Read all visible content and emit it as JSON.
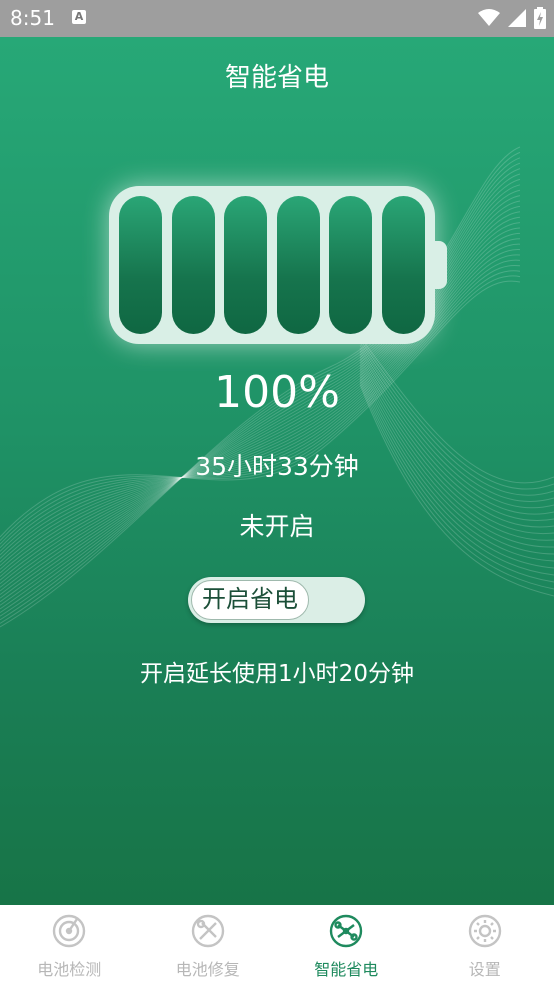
{
  "statusbar": {
    "time": "8:51",
    "notification_icon": "A"
  },
  "page": {
    "title": "智能省电"
  },
  "battery": {
    "percent": "100%",
    "remaining": "35小时33分钟",
    "state": "未开启",
    "cells": 6
  },
  "toggle": {
    "label": "开启省电"
  },
  "hint": "开启延长使用1小时20分钟",
  "colors": {
    "accent": "#1f8a5e",
    "inactive": "#b7b7b7"
  },
  "tabs": [
    {
      "label": "电池检测",
      "icon": "gauge-icon"
    },
    {
      "label": "电池修复",
      "icon": "repair-icon"
    },
    {
      "label": "智能省电",
      "icon": "power-save-icon"
    },
    {
      "label": "设置",
      "icon": "gear-icon"
    }
  ]
}
